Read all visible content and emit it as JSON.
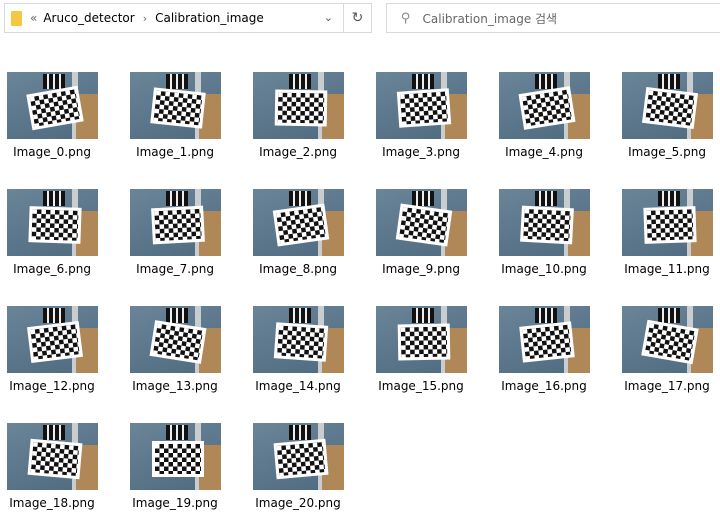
{
  "address": {
    "overflow": "«",
    "path": [
      "Aruco_detector",
      "Calibration_image"
    ]
  },
  "search": {
    "placeholder": "Calibration_image 검색"
  },
  "colors": {
    "wall": "#5a7589",
    "box": "#b08858"
  },
  "files": [
    "Image_0.png",
    "Image_1.png",
    "Image_2.png",
    "Image_3.png",
    "Image_4.png",
    "Image_5.png",
    "Image_6.png",
    "Image_7.png",
    "Image_8.png",
    "Image_9.png",
    "Image_10.png",
    "Image_11.png",
    "Image_12.png",
    "Image_13.png",
    "Image_14.png",
    "Image_15.png",
    "Image_16.png",
    "Image_17.png",
    "Image_18.png",
    "Image_19.png",
    "Image_20.png"
  ]
}
